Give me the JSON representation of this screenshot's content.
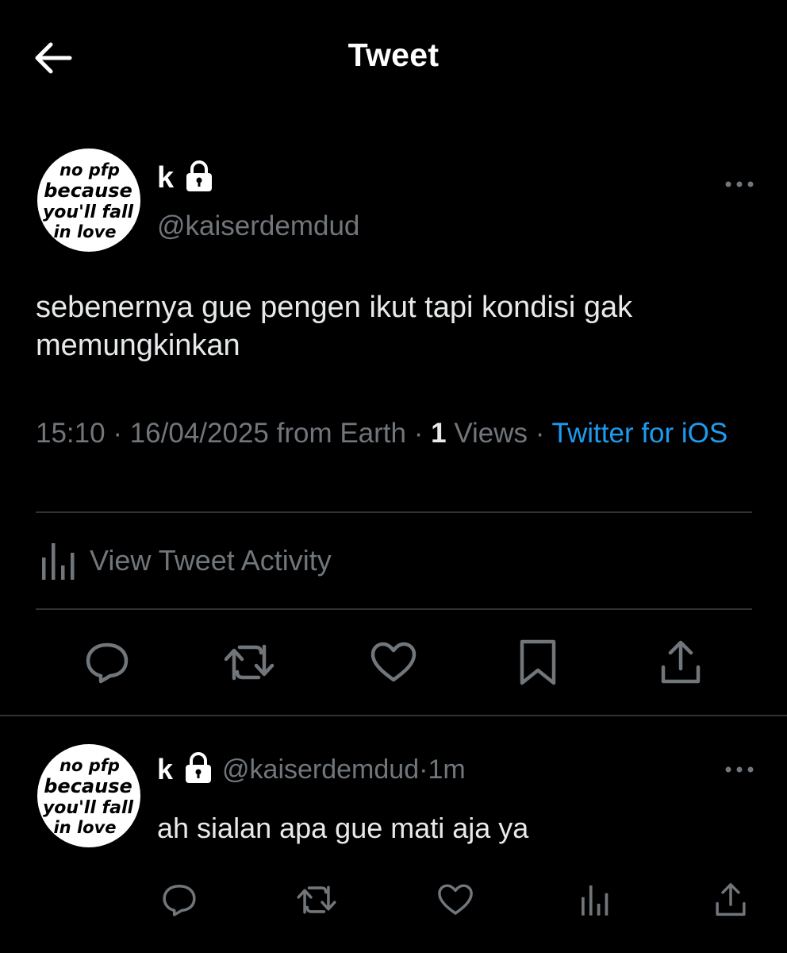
{
  "header": {
    "title": "Tweet",
    "back_icon": "arrow-left-icon"
  },
  "colors": {
    "background": "#000000",
    "text_primary": "#e7e9ea",
    "text_secondary": "#71767b",
    "link": "#1d9bf0",
    "divider": "#2f3336"
  },
  "avatar_text": [
    "no pfp",
    "because",
    "you'll fall",
    "in love"
  ],
  "tweet": {
    "display_name": "k",
    "handle": "@kaiserdemdud",
    "text": "sebenernya gue pengen ikut tapi kondisi gak memungkinkan",
    "time": "15:10",
    "date": "16/04/2025",
    "location": "from Earth",
    "separator": " · ",
    "views_count": "1",
    "views_label": "Views",
    "source": "Twitter for iOS",
    "activity_label": "View Tweet Activity",
    "actions": [
      "reply-icon",
      "retweet-icon",
      "like-icon",
      "bookmark-icon",
      "share-icon"
    ]
  },
  "reply": {
    "display_name": "k",
    "handle": "@kaiserdemdud",
    "separator": " · ",
    "time": "1m",
    "text": "ah sialan apa gue mati aja ya",
    "actions": [
      "reply-icon",
      "retweet-icon",
      "like-icon",
      "analytics-icon",
      "share-icon"
    ]
  }
}
